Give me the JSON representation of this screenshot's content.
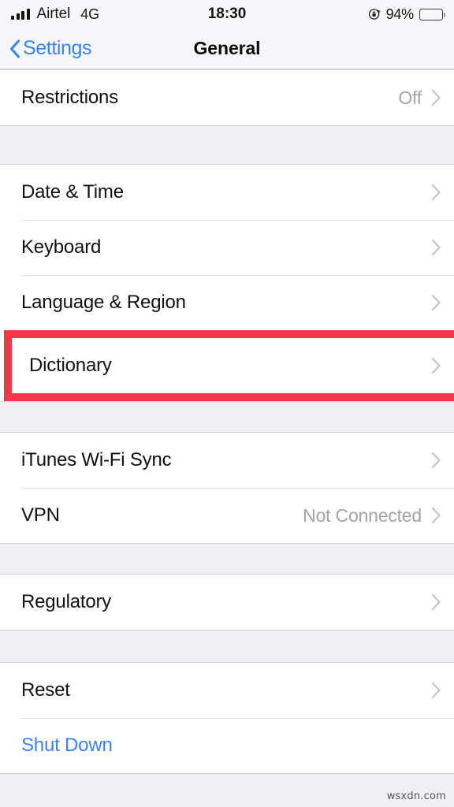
{
  "status_bar": {
    "carrier": "Airtel",
    "network": "4G",
    "time": "18:30",
    "battery_percent": "94%",
    "signal_icon": "signal-bars-icon",
    "rotation_lock_icon": "rotation-lock-icon",
    "battery_icon": "battery-full-icon"
  },
  "nav": {
    "back_label": "Settings",
    "back_icon": "chevron-left-icon",
    "title": "General"
  },
  "groups": [
    {
      "id": "restrictions-group",
      "rows": [
        {
          "name": "restrictions",
          "label": "Restrictions",
          "value": "Off",
          "chevron": true,
          "highlighted": false,
          "link": false
        }
      ]
    },
    {
      "id": "locale-group",
      "rows": [
        {
          "name": "date-and-time",
          "label": "Date & Time",
          "value": "",
          "chevron": true,
          "highlighted": false,
          "link": false
        },
        {
          "name": "keyboard",
          "label": "Keyboard",
          "value": "",
          "chevron": true,
          "highlighted": false,
          "link": false
        },
        {
          "name": "language-and-region",
          "label": "Language & Region",
          "value": "",
          "chevron": true,
          "highlighted": false,
          "link": false
        },
        {
          "name": "dictionary",
          "label": "Dictionary",
          "value": "",
          "chevron": true,
          "highlighted": true,
          "link": false
        }
      ]
    },
    {
      "id": "sync-group",
      "rows": [
        {
          "name": "itunes-wifi-sync",
          "label": "iTunes Wi-Fi Sync",
          "value": "",
          "chevron": true,
          "highlighted": false,
          "link": false
        },
        {
          "name": "vpn",
          "label": "VPN",
          "value": "Not Connected",
          "chevron": true,
          "highlighted": false,
          "link": false
        }
      ]
    },
    {
      "id": "regulatory-group",
      "rows": [
        {
          "name": "regulatory",
          "label": "Regulatory",
          "value": "",
          "chevron": true,
          "highlighted": false,
          "link": false
        }
      ]
    },
    {
      "id": "reset-group",
      "rows": [
        {
          "name": "reset",
          "label": "Reset",
          "value": "",
          "chevron": true,
          "highlighted": false,
          "link": false
        },
        {
          "name": "shut-down",
          "label": "Shut Down",
          "value": "",
          "chevron": false,
          "highlighted": false,
          "link": true
        }
      ]
    }
  ],
  "highlight": {
    "color": "#f23848",
    "target": "Dictionary"
  },
  "watermark": "wsxdn.com",
  "colors": {
    "accent_blue": "#3b81f3",
    "group_background": "#ffffff",
    "page_background": "#efeff4",
    "bar_background": "#f7f7f9",
    "secondary_text": "#a3a3a8"
  }
}
